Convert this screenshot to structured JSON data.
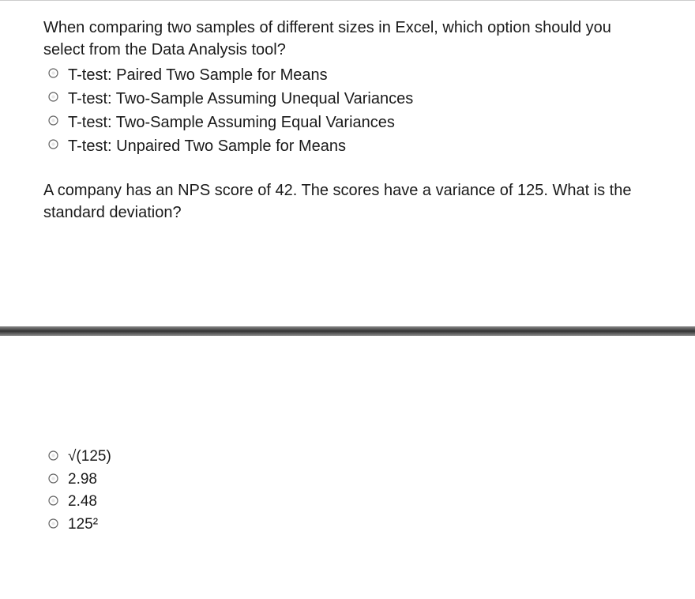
{
  "q1": {
    "text": "When comparing two samples of different sizes in Excel, which option should you select from the Data Analysis tool?",
    "options": [
      "T-test: Paired Two Sample for Means",
      "T-test: Two-Sample Assuming Unequal Variances",
      "T-test: Two-Sample Assuming Equal Variances",
      "T-test: Unpaired Two Sample for Means"
    ]
  },
  "q2": {
    "text": "A company has an NPS score of 42. The scores have a variance of 125. What is the standard deviation?",
    "options": [
      "√(125)",
      "2.98",
      "2.48",
      "125²"
    ]
  }
}
